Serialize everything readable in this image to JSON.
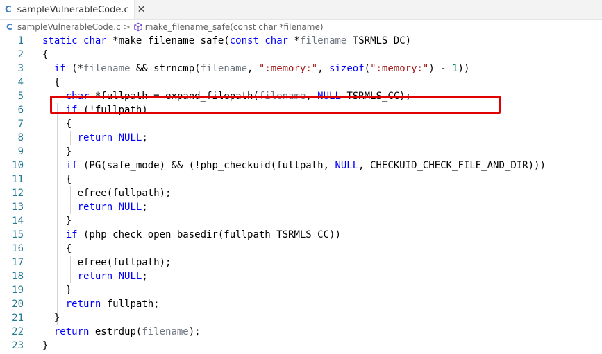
{
  "tab": {
    "label": "sampleVulnerableCode.c",
    "close_symbol": "✕",
    "icon": "c-file-icon"
  },
  "breadcrumb": {
    "file": "sampleVulnerableCode.c",
    "separator": ">",
    "symbol": "make_filename_safe(const char *filename)",
    "symbol_icon": "cube-icon"
  },
  "lines": [
    {
      "num": "1",
      "text": "static char *make_filename_safe(const char *filename TSRMLS_DC)"
    },
    {
      "num": "2",
      "text": "{"
    },
    {
      "num": "3",
      "text": "  if (*filename && strncmp(filename, \":memory:\", sizeof(\":memory:\") - 1))"
    },
    {
      "num": "4",
      "text": "  {"
    },
    {
      "num": "5",
      "text": "    char *fullpath = expand_filepath(filename, NULL TSRMLS_CC);"
    },
    {
      "num": "6",
      "text": "    if (!fullpath)"
    },
    {
      "num": "7",
      "text": "    {"
    },
    {
      "num": "8",
      "text": "      return NULL;"
    },
    {
      "num": "9",
      "text": "    }"
    },
    {
      "num": "10",
      "text": "    if (PG(safe_mode) && (!php_checkuid(fullpath, NULL, CHECKUID_CHECK_FILE_AND_DIR)))"
    },
    {
      "num": "11",
      "text": "    {"
    },
    {
      "num": "12",
      "text": "      efree(fullpath);"
    },
    {
      "num": "13",
      "text": "      return NULL;"
    },
    {
      "num": "14",
      "text": "    }"
    },
    {
      "num": "15",
      "text": "    if (php_check_open_basedir(fullpath TSRMLS_CC))"
    },
    {
      "num": "16",
      "text": "    {"
    },
    {
      "num": "17",
      "text": "      efree(fullpath);"
    },
    {
      "num": "18",
      "text": "      return NULL;"
    },
    {
      "num": "19",
      "text": "    }"
    },
    {
      "num": "20",
      "text": "    return fullpath;"
    },
    {
      "num": "21",
      "text": "  }"
    },
    {
      "num": "22",
      "text": "  return estrdup(filename);"
    },
    {
      "num": "23",
      "text": "}"
    }
  ],
  "highlight": {
    "line": "3",
    "color": "#e00000"
  }
}
